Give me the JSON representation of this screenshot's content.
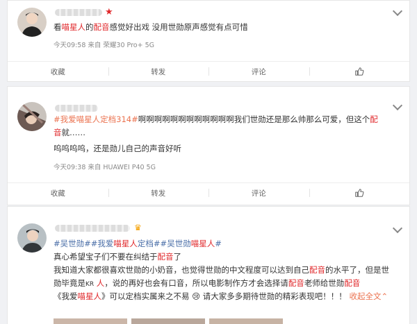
{
  "post1": {
    "line1": [
      {
        "t": "看",
        "c": "n"
      },
      {
        "t": "喵星人",
        "c": "r"
      },
      {
        "t": "的",
        "c": "n"
      },
      {
        "t": "配音",
        "c": "r"
      },
      {
        "t": "感觉好出戏 没用世勋原声感觉有点可惜",
        "c": "n"
      }
    ],
    "meta": "今天09:58 来自 荣耀30 Pro+ 5G"
  },
  "post2": {
    "line1": [
      {
        "t": "#我爱喵星人定档314#",
        "c": "l"
      },
      {
        "t": "啊啊啊啊啊啊啊啊啊啊啊啊我们世勋还是那么帅那么可爱，但这个",
        "c": "n"
      },
      {
        "t": "配",
        "c": "r"
      }
    ],
    "line2": [
      {
        "t": "音",
        "c": "r"
      },
      {
        "t": "就……",
        "c": "n"
      }
    ],
    "line3": [
      {
        "t": "呜呜呜呜，还是勋儿自己的声音好听",
        "c": "n"
      }
    ],
    "meta": "今天09:38 来自 HUAWEI P40 5G"
  },
  "post3": {
    "line1": [
      {
        "t": "#吴世勋##我爱",
        "c": "b"
      },
      {
        "t": "喵星人",
        "c": "r"
      },
      {
        "t": "定档##吴世勋",
        "c": "b"
      },
      {
        "t": "喵星人",
        "c": "r"
      },
      {
        "t": "#",
        "c": "b"
      }
    ],
    "line2": [
      {
        "t": "真心希望宝子们不要在纠结于",
        "c": "n"
      },
      {
        "t": "配音",
        "c": "r"
      },
      {
        "t": "了",
        "c": "n"
      }
    ],
    "line3": [
      {
        "t": "我知道大家都很喜欢世勋的小奶音，也觉得世勋的中文程度可以达到自己",
        "c": "n"
      },
      {
        "t": "配音",
        "c": "r"
      },
      {
        "t": "的水平了，但是世",
        "c": "n"
      }
    ],
    "line4": [
      {
        "t": "勋毕竟是",
        "c": "n"
      },
      {
        "t": "KR",
        "c": "s"
      },
      {
        "t": " 人",
        "c": "r"
      },
      {
        "t": "，说的再好也会有口音，所以电影制作方才会选择请",
        "c": "n"
      },
      {
        "t": "配音",
        "c": "r"
      },
      {
        "t": "老师给世勋",
        "c": "n"
      },
      {
        "t": "配音",
        "c": "r"
      }
    ],
    "line5": [
      {
        "t": "《我爱",
        "c": "n"
      },
      {
        "t": "喵星人",
        "c": "r"
      },
      {
        "t": "》可以定档实属来之不易 ",
        "c": "n"
      },
      {
        "t": "😢",
        "c": "e"
      },
      {
        "t": " 请大家多多期待世勋的精彩表现吧！！！ ",
        "c": "n"
      },
      {
        "t": "收起全文",
        "c": "l"
      },
      {
        "t": "⌃",
        "c": "l"
      }
    ]
  },
  "actions": {
    "collect": "收藏",
    "repost": "转发",
    "comment": "评论"
  },
  "icons": {
    "like": "thumbs-up-icon",
    "expand": "chevron-down-icon",
    "verified": "red-star-icon",
    "vip": "vip-crown-icon"
  },
  "colors": {
    "keyword_red": "#e0282b",
    "topic_link": "#eb7350",
    "topic_blue": "#4b6fa8",
    "meta_gray": "#8a8a8a"
  }
}
